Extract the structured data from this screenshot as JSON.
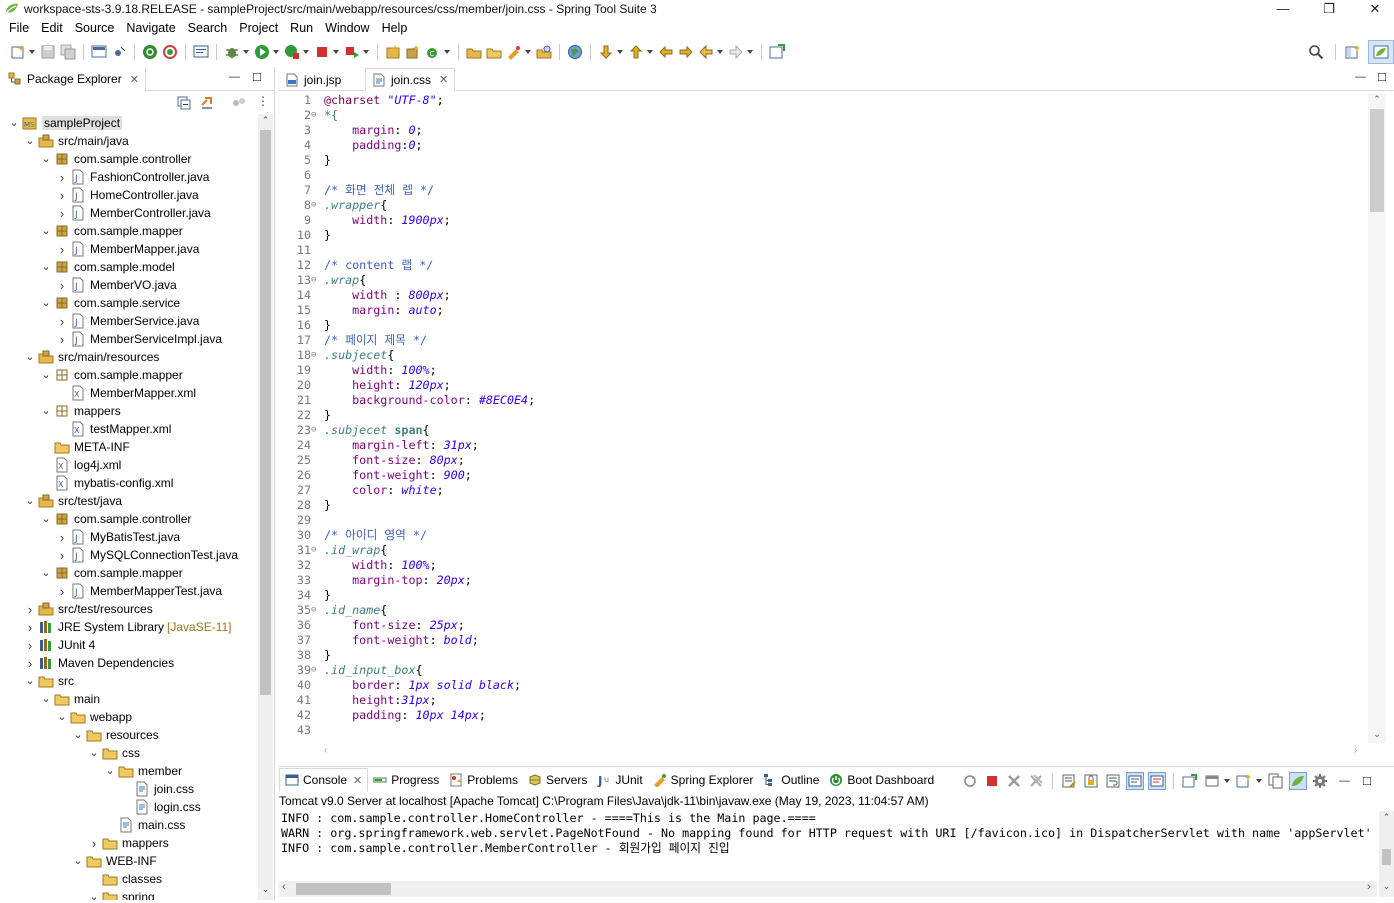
{
  "window": {
    "title": "workspace-sts-3.9.18.RELEASE - sampleProject/src/main/webapp/resources/css/member/join.css - Spring Tool Suite 3",
    "minimize": "—",
    "restore": "❐",
    "close": "✕"
  },
  "menu": [
    "File",
    "Edit",
    "Source",
    "Navigate",
    "Search",
    "Project",
    "Run",
    "Window",
    "Help"
  ],
  "package_explorer": {
    "tab_label": "Package Explorer",
    "tree": [
      {
        "depth": 0,
        "expanded": true,
        "icon": "project-icon",
        "label": "sampleProject",
        "selected": true
      },
      {
        "depth": 1,
        "expanded": true,
        "icon": "source-folder-icon",
        "label": "src/main/java"
      },
      {
        "depth": 2,
        "expanded": true,
        "icon": "package-icon",
        "label": "com.sample.controller"
      },
      {
        "depth": 3,
        "expanded": false,
        "icon": "java-file-icon",
        "label": "FashionController.java"
      },
      {
        "depth": 3,
        "expanded": false,
        "icon": "java-file-icon",
        "label": "HomeController.java"
      },
      {
        "depth": 3,
        "expanded": false,
        "icon": "java-file-icon",
        "label": "MemberController.java"
      },
      {
        "depth": 2,
        "expanded": true,
        "icon": "package-icon",
        "label": "com.sample.mapper"
      },
      {
        "depth": 3,
        "expanded": false,
        "icon": "java-interface-icon",
        "label": "MemberMapper.java"
      },
      {
        "depth": 2,
        "expanded": true,
        "icon": "package-icon",
        "label": "com.sample.model"
      },
      {
        "depth": 3,
        "expanded": false,
        "icon": "java-file-icon",
        "label": "MemberVO.java"
      },
      {
        "depth": 2,
        "expanded": true,
        "icon": "package-icon",
        "label": "com.sample.service"
      },
      {
        "depth": 3,
        "expanded": false,
        "icon": "java-interface-icon",
        "label": "MemberService.java"
      },
      {
        "depth": 3,
        "expanded": false,
        "icon": "java-file-icon",
        "label": "MemberServiceImpl.java"
      },
      {
        "depth": 1,
        "expanded": true,
        "icon": "source-folder-icon",
        "label": "src/main/resources"
      },
      {
        "depth": 2,
        "expanded": true,
        "icon": "package-folder-icon",
        "label": "com.sample.mapper"
      },
      {
        "depth": 3,
        "expanded": null,
        "icon": "xml-file-icon",
        "label": "MemberMapper.xml"
      },
      {
        "depth": 2,
        "expanded": true,
        "icon": "package-folder-icon",
        "label": "mappers"
      },
      {
        "depth": 3,
        "expanded": null,
        "icon": "xml-file-icon",
        "label": "testMapper.xml"
      },
      {
        "depth": 2,
        "expanded": null,
        "icon": "folder-icon",
        "label": "META-INF"
      },
      {
        "depth": 2,
        "expanded": null,
        "icon": "xml-file-icon",
        "label": "log4j.xml"
      },
      {
        "depth": 2,
        "expanded": null,
        "icon": "xml-file-icon",
        "label": "mybatis-config.xml"
      },
      {
        "depth": 1,
        "expanded": true,
        "icon": "source-folder-icon",
        "label": "src/test/java"
      },
      {
        "depth": 2,
        "expanded": true,
        "icon": "package-icon",
        "label": "com.sample.controller"
      },
      {
        "depth": 3,
        "expanded": false,
        "icon": "java-file-icon",
        "label": "MyBatisTest.java"
      },
      {
        "depth": 3,
        "expanded": false,
        "icon": "java-file-icon",
        "label": "MySQLConnectionTest.java"
      },
      {
        "depth": 2,
        "expanded": true,
        "icon": "package-icon",
        "label": "com.sample.mapper"
      },
      {
        "depth": 3,
        "expanded": false,
        "icon": "java-file-icon",
        "label": "MemberMapperTest.java"
      },
      {
        "depth": 1,
        "expanded": false,
        "icon": "source-folder-icon",
        "label": "src/test/resources"
      },
      {
        "depth": 1,
        "expanded": false,
        "icon": "library-icon",
        "label": "JRE System Library",
        "decoration": "[JavaSE-11]"
      },
      {
        "depth": 1,
        "expanded": false,
        "icon": "library-icon",
        "label": "JUnit 4"
      },
      {
        "depth": 1,
        "expanded": false,
        "icon": "library-icon",
        "label": "Maven Dependencies"
      },
      {
        "depth": 1,
        "expanded": true,
        "icon": "folder-icon",
        "label": "src"
      },
      {
        "depth": 2,
        "expanded": true,
        "icon": "folder-icon",
        "label": "main"
      },
      {
        "depth": 3,
        "expanded": true,
        "icon": "folder-icon",
        "label": "webapp"
      },
      {
        "depth": 4,
        "expanded": true,
        "icon": "folder-icon",
        "label": "resources"
      },
      {
        "depth": 5,
        "expanded": true,
        "icon": "folder-icon",
        "label": "css"
      },
      {
        "depth": 6,
        "expanded": true,
        "icon": "folder-icon",
        "label": "member"
      },
      {
        "depth": 7,
        "expanded": null,
        "icon": "css-file-icon",
        "label": "join.css"
      },
      {
        "depth": 7,
        "expanded": null,
        "icon": "css-file-icon",
        "label": "login.css"
      },
      {
        "depth": 6,
        "expanded": null,
        "icon": "css-file-icon",
        "label": "main.css"
      },
      {
        "depth": 5,
        "expanded": false,
        "icon": "folder-icon",
        "label": "mappers"
      },
      {
        "depth": 4,
        "expanded": true,
        "icon": "folder-icon",
        "label": "WEB-INF"
      },
      {
        "depth": 5,
        "expanded": null,
        "icon": "folder-icon",
        "label": "classes"
      },
      {
        "depth": 5,
        "expanded": true,
        "icon": "folder-icon",
        "label": "spring"
      }
    ]
  },
  "editor": {
    "tabs": [
      {
        "label": "join.jsp",
        "icon": "jsp-file-icon",
        "active": false
      },
      {
        "label": "join.css",
        "icon": "css-file-icon",
        "active": true
      }
    ],
    "lines": [
      {
        "n": "1",
        "fold": "",
        "parts": [
          [
            "c-at",
            "@charset "
          ],
          [
            "c-str",
            "\"UTF-8\""
          ],
          [
            "c-plain",
            ";"
          ]
        ]
      },
      {
        "n": "2",
        "fold": "⊖",
        "parts": [
          [
            "c-sel",
            "*{"
          ]
        ]
      },
      {
        "n": "3",
        "fold": "",
        "parts": [
          [
            "c-prop",
            "    margin"
          ],
          [
            "c-plain",
            ": "
          ],
          [
            "c-val",
            "0"
          ],
          [
            "c-plain",
            ";"
          ]
        ]
      },
      {
        "n": "4",
        "fold": "",
        "parts": [
          [
            "c-prop",
            "    padding"
          ],
          [
            "c-plain",
            ":"
          ],
          [
            "c-val",
            "0"
          ],
          [
            "c-plain",
            ";"
          ]
        ]
      },
      {
        "n": "5",
        "fold": "",
        "parts": [
          [
            "c-plain",
            "}"
          ]
        ]
      },
      {
        "n": "6",
        "fold": "",
        "parts": []
      },
      {
        "n": "7",
        "fold": "",
        "parts": [
          [
            "c-comment",
            "/* 화면 전체 렙 */"
          ]
        ]
      },
      {
        "n": "8",
        "fold": "⊖",
        "parts": [
          [
            "c-sel-i",
            ".wrapper"
          ],
          [
            "c-plain",
            "{"
          ]
        ]
      },
      {
        "n": "9",
        "fold": "",
        "parts": [
          [
            "c-prop",
            "    width"
          ],
          [
            "c-plain",
            ": "
          ],
          [
            "c-val",
            "1900px"
          ],
          [
            "c-plain",
            ";"
          ]
        ]
      },
      {
        "n": "10",
        "fold": "",
        "parts": [
          [
            "c-plain",
            "}"
          ]
        ]
      },
      {
        "n": "11",
        "fold": "",
        "parts": []
      },
      {
        "n": "12",
        "fold": "",
        "parts": [
          [
            "c-comment",
            "/* content 랩 */"
          ]
        ]
      },
      {
        "n": "13",
        "fold": "⊖",
        "parts": [
          [
            "c-sel-i",
            ".wrap"
          ],
          [
            "c-plain",
            "{"
          ]
        ]
      },
      {
        "n": "14",
        "fold": "",
        "parts": [
          [
            "c-prop",
            "    width "
          ],
          [
            "c-plain",
            ": "
          ],
          [
            "c-val",
            "800px"
          ],
          [
            "c-plain",
            ";"
          ]
        ]
      },
      {
        "n": "15",
        "fold": "",
        "parts": [
          [
            "c-prop",
            "    margin"
          ],
          [
            "c-plain",
            ": "
          ],
          [
            "c-val",
            "auto"
          ],
          [
            "c-plain",
            ";"
          ]
        ]
      },
      {
        "n": "16",
        "fold": "",
        "parts": [
          [
            "c-plain",
            "}"
          ]
        ]
      },
      {
        "n": "17",
        "fold": "",
        "parts": [
          [
            "c-comment",
            "/* 페이지 제목 */"
          ]
        ]
      },
      {
        "n": "18",
        "fold": "⊖",
        "parts": [
          [
            "c-sel-i",
            ".subjecet"
          ],
          [
            "c-plain",
            "{"
          ]
        ]
      },
      {
        "n": "19",
        "fold": "",
        "parts": [
          [
            "c-prop",
            "    width"
          ],
          [
            "c-plain",
            ": "
          ],
          [
            "c-val",
            "100%"
          ],
          [
            "c-plain",
            ";"
          ]
        ]
      },
      {
        "n": "20",
        "fold": "",
        "parts": [
          [
            "c-prop",
            "    height"
          ],
          [
            "c-plain",
            ": "
          ],
          [
            "c-val",
            "120px"
          ],
          [
            "c-plain",
            ";"
          ]
        ]
      },
      {
        "n": "21",
        "fold": "",
        "parts": [
          [
            "c-prop",
            "    background-color"
          ],
          [
            "c-plain",
            ": "
          ],
          [
            "c-val",
            "#8EC0E4"
          ],
          [
            "c-plain",
            ";"
          ]
        ]
      },
      {
        "n": "22",
        "fold": "",
        "parts": [
          [
            "c-plain",
            "}"
          ]
        ]
      },
      {
        "n": "23",
        "fold": "⊖",
        "parts": [
          [
            "c-sel-i",
            ".subjecet "
          ],
          [
            "c-tag",
            "span"
          ],
          [
            "c-plain",
            "{"
          ]
        ]
      },
      {
        "n": "24",
        "fold": "",
        "parts": [
          [
            "c-prop",
            "    margin-left"
          ],
          [
            "c-plain",
            ": "
          ],
          [
            "c-val",
            "31px"
          ],
          [
            "c-plain",
            ";"
          ]
        ]
      },
      {
        "n": "25",
        "fold": "",
        "parts": [
          [
            "c-prop",
            "    font-size"
          ],
          [
            "c-plain",
            ": "
          ],
          [
            "c-val",
            "80px"
          ],
          [
            "c-plain",
            ";"
          ]
        ]
      },
      {
        "n": "26",
        "fold": "",
        "parts": [
          [
            "c-prop",
            "    font-weight"
          ],
          [
            "c-plain",
            ": "
          ],
          [
            "c-val",
            "900"
          ],
          [
            "c-plain",
            ";"
          ]
        ]
      },
      {
        "n": "27",
        "fold": "",
        "parts": [
          [
            "c-prop",
            "    color"
          ],
          [
            "c-plain",
            ": "
          ],
          [
            "c-val",
            "white"
          ],
          [
            "c-plain",
            ";"
          ]
        ]
      },
      {
        "n": "28",
        "fold": "",
        "parts": [
          [
            "c-plain",
            "}"
          ]
        ]
      },
      {
        "n": "29",
        "fold": "",
        "parts": []
      },
      {
        "n": "30",
        "fold": "",
        "parts": [
          [
            "c-comment",
            "/* 아이디 영역 */"
          ]
        ]
      },
      {
        "n": "31",
        "fold": "⊖",
        "parts": [
          [
            "c-sel-i",
            ".id_wrap"
          ],
          [
            "c-plain",
            "{"
          ]
        ]
      },
      {
        "n": "32",
        "fold": "",
        "parts": [
          [
            "c-prop",
            "    width"
          ],
          [
            "c-plain",
            ": "
          ],
          [
            "c-val",
            "100%"
          ],
          [
            "c-plain",
            ";"
          ]
        ]
      },
      {
        "n": "33",
        "fold": "",
        "parts": [
          [
            "c-prop",
            "    margin-top"
          ],
          [
            "c-plain",
            ": "
          ],
          [
            "c-val",
            "20px"
          ],
          [
            "c-plain",
            ";"
          ]
        ]
      },
      {
        "n": "34",
        "fold": "",
        "parts": [
          [
            "c-plain",
            "}"
          ]
        ]
      },
      {
        "n": "35",
        "fold": "⊖",
        "parts": [
          [
            "c-sel-i",
            ".id_name"
          ],
          [
            "c-plain",
            "{"
          ]
        ]
      },
      {
        "n": "36",
        "fold": "",
        "parts": [
          [
            "c-prop",
            "    font-size"
          ],
          [
            "c-plain",
            ": "
          ],
          [
            "c-val",
            "25px"
          ],
          [
            "c-plain",
            ";"
          ]
        ]
      },
      {
        "n": "37",
        "fold": "",
        "parts": [
          [
            "c-prop",
            "    font-weight"
          ],
          [
            "c-plain",
            ": "
          ],
          [
            "c-val",
            "bold"
          ],
          [
            "c-plain",
            ";"
          ]
        ]
      },
      {
        "n": "38",
        "fold": "",
        "parts": [
          [
            "c-plain",
            "}"
          ]
        ]
      },
      {
        "n": "39",
        "fold": "⊖",
        "parts": [
          [
            "c-sel-i",
            ".id_input_box"
          ],
          [
            "c-plain",
            "{"
          ]
        ]
      },
      {
        "n": "40",
        "fold": "",
        "parts": [
          [
            "c-prop",
            "    border"
          ],
          [
            "c-plain",
            ": "
          ],
          [
            "c-val",
            "1px solid black"
          ],
          [
            "c-plain",
            ";"
          ]
        ]
      },
      {
        "n": "41",
        "fold": "",
        "parts": [
          [
            "c-prop",
            "    height"
          ],
          [
            "c-plain",
            ":"
          ],
          [
            "c-val",
            "31px"
          ],
          [
            "c-plain",
            ";"
          ]
        ]
      },
      {
        "n": "42",
        "fold": "",
        "parts": [
          [
            "c-prop",
            "    padding"
          ],
          [
            "c-plain",
            ": "
          ],
          [
            "c-val",
            "10px 14px"
          ],
          [
            "c-plain",
            ";"
          ]
        ]
      },
      {
        "n": "43",
        "fold": "",
        "parts": []
      }
    ]
  },
  "bottom_panel": {
    "tabs": [
      {
        "label": "Console",
        "icon": "console-icon",
        "active": true
      },
      {
        "label": "Progress",
        "icon": "progress-icon"
      },
      {
        "label": "Problems",
        "icon": "problems-icon"
      },
      {
        "label": "Servers",
        "icon": "servers-icon"
      },
      {
        "label": "JUnit",
        "icon": "junit-icon"
      },
      {
        "label": "Spring Explorer",
        "icon": "spring-explorer-icon"
      },
      {
        "label": "Outline",
        "icon": "outline-icon"
      },
      {
        "label": "Boot Dashboard",
        "icon": "boot-dashboard-icon"
      }
    ],
    "console_title": "Tomcat v9.0 Server at localhost [Apache Tomcat] C:\\Program Files\\Java\\jdk-11\\bin\\javaw.exe  (May 19, 2023, 11:04:57 AM)",
    "console_lines": [
      "INFO : com.sample.controller.HomeController - ====This is the Main page.====",
      "WARN : org.springframework.web.servlet.PageNotFound - No mapping found for HTTP request with URI [/favicon.ico] in DispatcherServlet with name 'appServlet'",
      "INFO : com.sample.controller.MemberController - 회원가입 페이지 진입"
    ]
  },
  "colors": {
    "accent": "#3a78c9",
    "selection": "#e0e0e0",
    "library_decoration": "#9a7a1a"
  }
}
